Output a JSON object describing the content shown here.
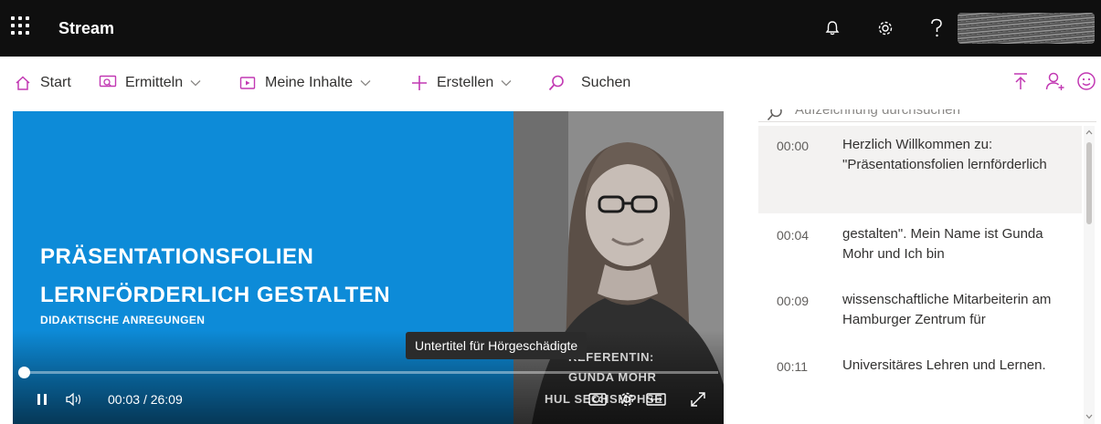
{
  "app": {
    "title": "Stream"
  },
  "nav": {
    "start": "Start",
    "ermitteln": "Ermitteln",
    "meine_inhalte": "Meine Inhalte",
    "erstellen": "Erstellen",
    "suchen": "Suchen"
  },
  "video": {
    "title_line1": "PRÄSENTATIONSFOLIEN",
    "title_line2": "LERNFÖRDERLICH GESTALTEN",
    "subtitle": "DIDAKTISCHE ANREGUNGEN",
    "referentin_label": "REFERENTIN:",
    "referentin_name": "GUNDA MOHR",
    "referentin_org": "HUL SECHSMPHSE",
    "current_time": "00:03",
    "total_time": "26:09",
    "time_separator": "/",
    "progress_fraction": 0.002,
    "tooltip": "Untertitel für Hörgeschädigte"
  },
  "transcript": {
    "search_placeholder": "Aufzeichnung durchsuchen",
    "entries": [
      {
        "time": "00:00",
        "text": "Herzlich Willkommen zu: \"Präsentationsfolien lernförderlich"
      },
      {
        "time": "00:04",
        "text": "gestalten\". Mein Name ist Gunda Mohr und Ich bin"
      },
      {
        "time": "00:09",
        "text": "wissenschaftliche Mitarbeiterin am Hamburger Zentrum für"
      },
      {
        "time": "00:11",
        "text": "Universitäres Lehren und Lernen."
      }
    ]
  },
  "colors": {
    "topbar": "#0f0f0f",
    "accent": "#c239b3",
    "slide_blue": "#0d8bd8"
  },
  "icons": [
    "waffle-icon",
    "bell-icon",
    "gear-icon",
    "help-icon",
    "home-icon",
    "discover-icon",
    "my-content-icon",
    "plus-icon",
    "search-icon",
    "upload-icon",
    "add-person-icon",
    "smiley-icon",
    "pause-icon",
    "volume-icon",
    "captions-icon",
    "settings-icon",
    "theater-icon",
    "fullscreen-icon"
  ]
}
